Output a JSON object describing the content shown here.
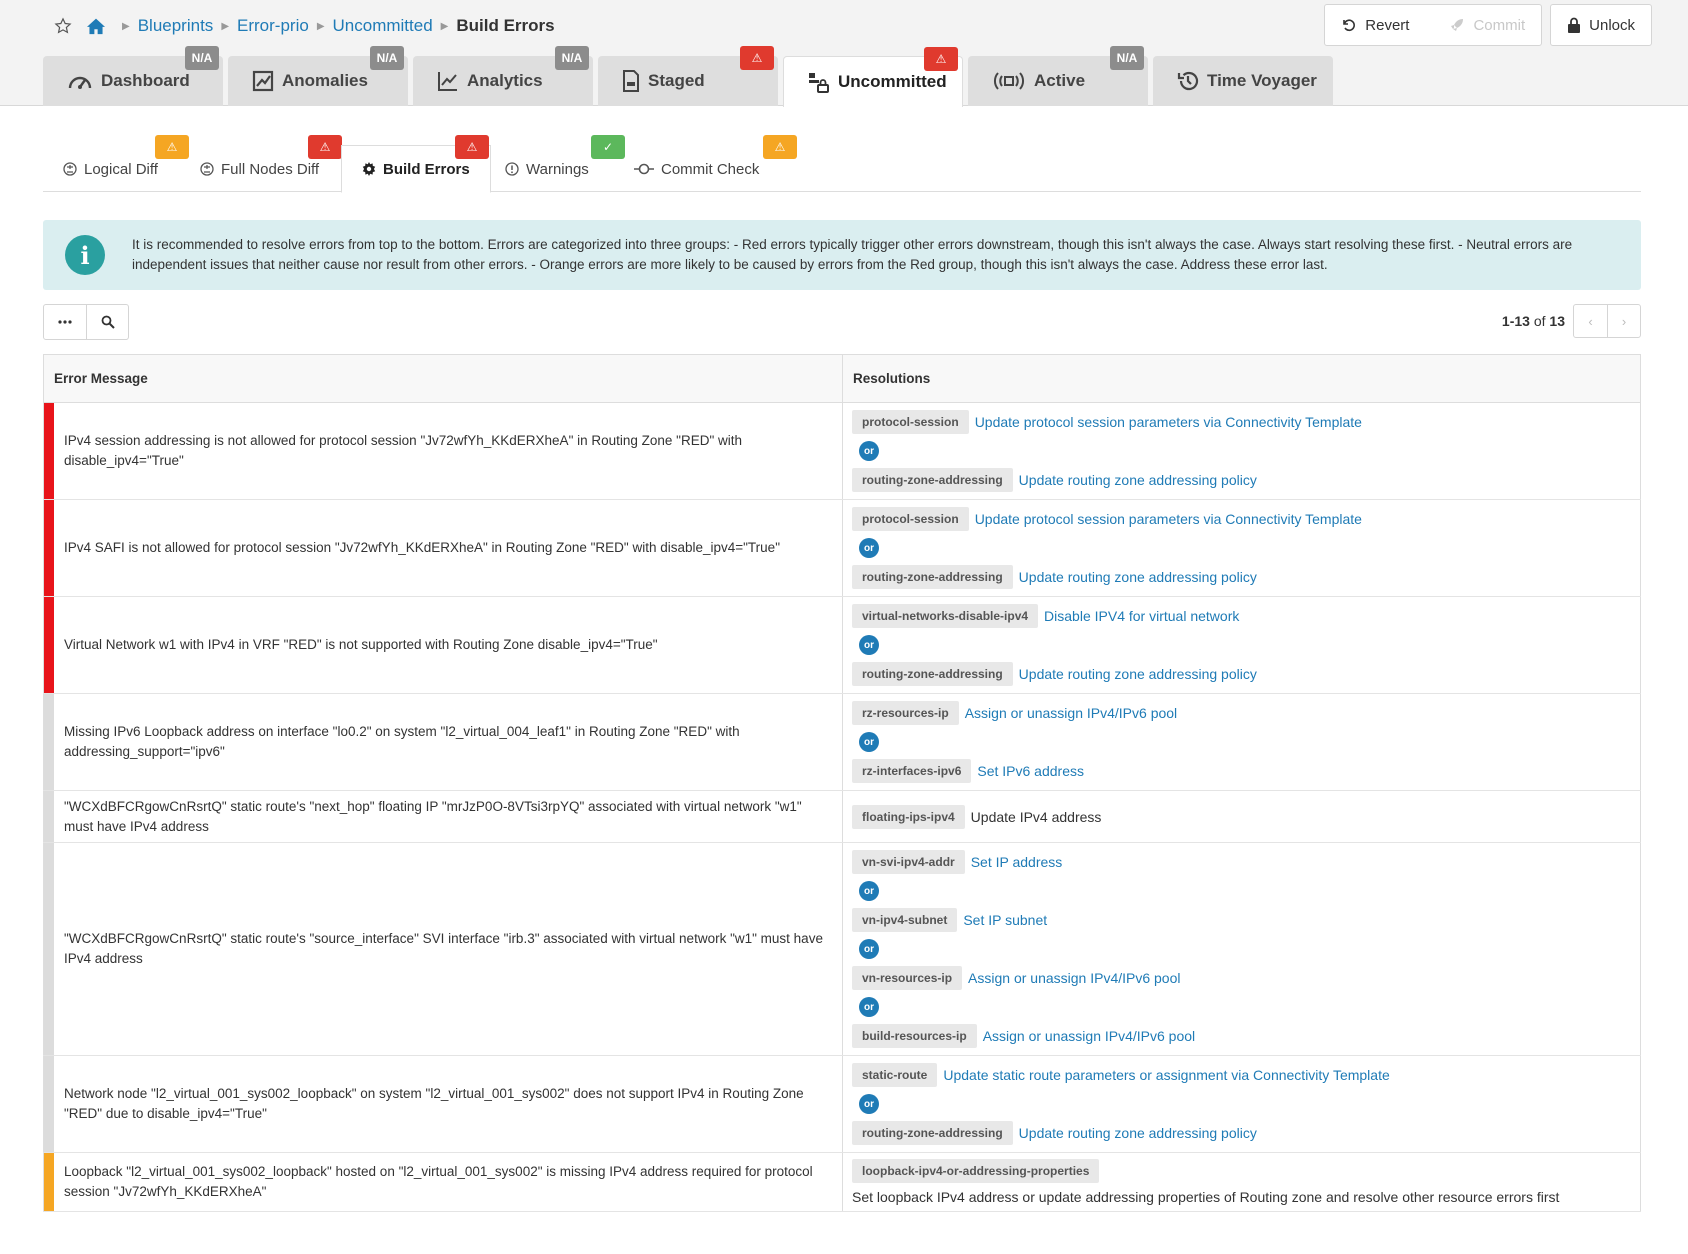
{
  "breadcrumb": {
    "items": [
      "Blueprints",
      "Error-prio",
      "Uncommitted"
    ],
    "current": "Build Errors"
  },
  "actions": {
    "revert": "Revert",
    "commit": "Commit",
    "unlock": "Unlock"
  },
  "tabs": [
    {
      "label": "Dashboard",
      "icon": "dashboard-icon",
      "badge": "N/A",
      "badge_type": "na"
    },
    {
      "label": "Anomalies",
      "icon": "anomalies-icon",
      "badge": "N/A",
      "badge_type": "na"
    },
    {
      "label": "Analytics",
      "icon": "analytics-icon",
      "badge": "N/A",
      "badge_type": "na"
    },
    {
      "label": "Staged",
      "icon": "staged-icon",
      "badge": "⚠",
      "badge_type": "red"
    },
    {
      "label": "Uncommitted",
      "icon": "uncommitted-icon",
      "badge": "⚠",
      "badge_type": "red",
      "active": true
    },
    {
      "label": "Active",
      "icon": "active-icon",
      "badge": "N/A",
      "badge_type": "na"
    },
    {
      "label": "Time Voyager",
      "icon": "time-voyager-icon",
      "badge": "",
      "badge_type": ""
    }
  ],
  "subtabs": [
    {
      "label": "Logical Diff",
      "badge": "⚠",
      "badge_type": "orange"
    },
    {
      "label": "Full Nodes Diff",
      "badge": "⚠",
      "badge_type": "red"
    },
    {
      "label": "Build Errors",
      "badge": "⚠",
      "badge_type": "red",
      "active": true
    },
    {
      "label": "Warnings",
      "badge": "✓",
      "badge_type": "green"
    },
    {
      "label": "Commit Check",
      "badge": "⚠",
      "badge_type": "orange"
    }
  ],
  "info": {
    "text": "It is recommended to resolve errors from top to the bottom. Errors are categorized into three groups: - Red errors typically trigger other errors downstream, though this isn't always the case. Always start resolving these first. - Neutral errors are independent issues that neither cause nor result from other errors. - Orange errors are more likely to be caused by errors from the Red group, though this isn't always the case. Address these error last."
  },
  "pager": {
    "range": "1-13",
    "of": "of",
    "total": "13"
  },
  "table": {
    "headers": [
      "Error Message",
      "Resolutions"
    ],
    "or_label": "or",
    "rows": [
      {
        "severity": "red",
        "message": "IPv4 session addressing is not allowed for protocol session \"Jv72wfYh_KKdERXheA\" in Routing Zone \"RED\" with disable_ipv4=\"True\"",
        "resolutions": [
          {
            "tag": "protocol-session",
            "text": "Update protocol session parameters via Connectivity Template",
            "link": true
          },
          {
            "tag": "routing-zone-addressing",
            "text": "Update routing zone addressing policy",
            "link": true
          }
        ]
      },
      {
        "severity": "red",
        "message": "IPv4 SAFI is not allowed for protocol session \"Jv72wfYh_KKdERXheA\" in Routing Zone \"RED\" with disable_ipv4=\"True\"",
        "resolutions": [
          {
            "tag": "protocol-session",
            "text": "Update protocol session parameters via Connectivity Template",
            "link": true
          },
          {
            "tag": "routing-zone-addressing",
            "text": "Update routing zone addressing policy",
            "link": true
          }
        ]
      },
      {
        "severity": "red",
        "message": "Virtual Network w1 with IPv4 in VRF \"RED\" is not supported with Routing Zone disable_ipv4=\"True\"",
        "resolutions": [
          {
            "tag": "virtual-networks-disable-ipv4",
            "text": "Disable IPV4 for virtual network",
            "link": true
          },
          {
            "tag": "routing-zone-addressing",
            "text": "Update routing zone addressing policy",
            "link": true
          }
        ]
      },
      {
        "severity": "neutral",
        "message": "Missing IPv6 Loopback address on interface \"lo0.2\" on system \"l2_virtual_004_leaf1\" in Routing Zone \"RED\" with addressing_support=\"ipv6\"",
        "resolutions": [
          {
            "tag": "rz-resources-ip",
            "text": "Assign or unassign IPv4/IPv6 pool",
            "link": true
          },
          {
            "tag": "rz-interfaces-ipv6",
            "text": "Set IPv6 address",
            "link": true
          }
        ]
      },
      {
        "severity": "neutral",
        "message": "\"WCXdBFCRgowCnRsrtQ\" static route's \"next_hop\" floating IP \"mrJzP0O-8VTsi3rpYQ\" associated with virtual network \"w1\" must have IPv4 address",
        "resolutions": [
          {
            "tag": "floating-ips-ipv4",
            "text": "Update IPv4 address",
            "link": false
          }
        ]
      },
      {
        "severity": "neutral",
        "message": "\"WCXdBFCRgowCnRsrtQ\" static route's \"source_interface\" SVI interface \"irb.3\" associated with virtual network \"w1\" must have IPv4 address",
        "resolutions": [
          {
            "tag": "vn-svi-ipv4-addr",
            "text": "Set IP address",
            "link": true
          },
          {
            "tag": "vn-ipv4-subnet",
            "text": "Set IP subnet",
            "link": true
          },
          {
            "tag": "vn-resources-ip",
            "text": "Assign or unassign IPv4/IPv6 pool",
            "link": true
          },
          {
            "tag": "build-resources-ip",
            "text": "Assign or unassign IPv4/IPv6 pool",
            "link": true
          }
        ]
      },
      {
        "severity": "neutral",
        "message": "Network node \"l2_virtual_001_sys002_loopback\" on system \"l2_virtual_001_sys002\" does not support IPv4 in Routing Zone \"RED\" due to disable_ipv4=\"True\"",
        "resolutions": [
          {
            "tag": "static-route",
            "text": "Update static route parameters or assignment via Connectivity Template",
            "link": true
          },
          {
            "tag": "routing-zone-addressing",
            "text": "Update routing zone addressing policy",
            "link": true
          }
        ]
      },
      {
        "severity": "orange",
        "message": "Loopback \"l2_virtual_001_sys002_loopback\" hosted on \"l2_virtual_001_sys002\" is missing IPv4 address required for protocol session \"Jv72wfYh_KKdERXheA\"",
        "resolutions": [
          {
            "tag": "loopback-ipv4-or-addressing-properties",
            "text": "Set loopback IPv4 address or update addressing properties of Routing zone and resolve other resource errors first",
            "link": false
          }
        ]
      }
    ]
  },
  "colors": {
    "red": "#e8141a",
    "orange": "#f5a623",
    "neutral": "#dcdcdc",
    "link": "#1f7bb6"
  }
}
